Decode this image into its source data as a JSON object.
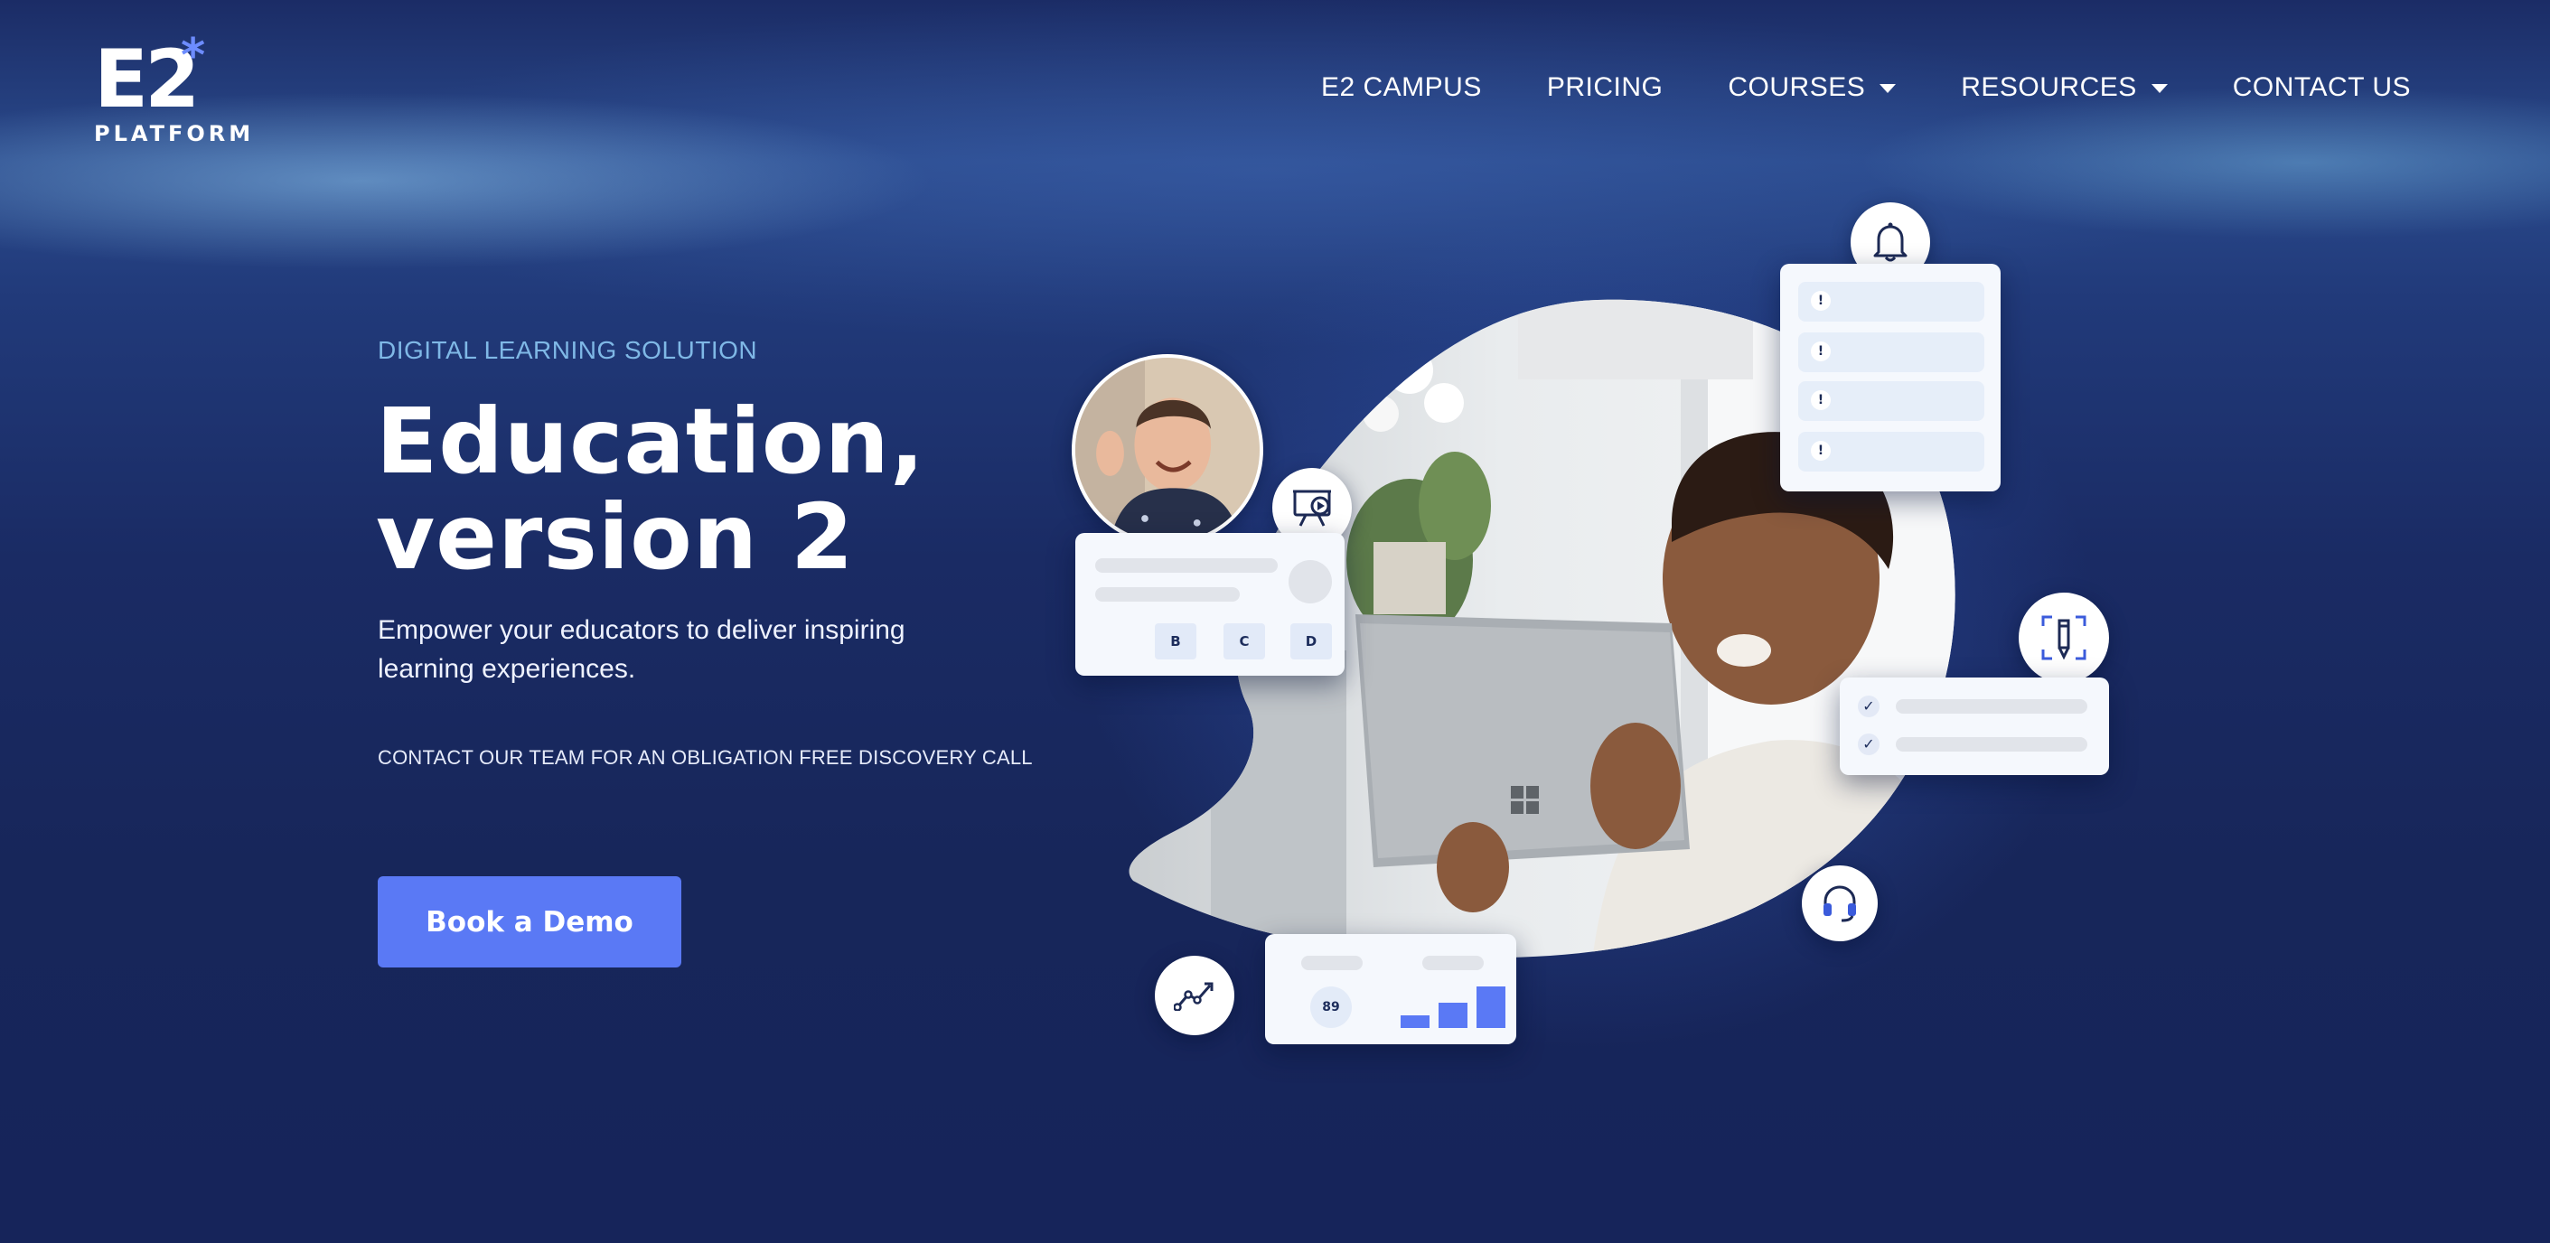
{
  "logo": {
    "mark": "E2",
    "star": "*",
    "sub": "PLATFORM"
  },
  "nav": {
    "campus": "E2 CAMPUS",
    "pricing": "PRICING",
    "courses": "COURSES",
    "resources": "RESOURCES",
    "contact": "CONTACT US"
  },
  "hero": {
    "eyebrow": "DIGITAL LEARNING SOLUTION",
    "headline_line1": "Education,",
    "headline_line2": "version 2",
    "subtitle": "Empower your educators to deliver inspiring learning experiences.",
    "cta_note": "CONTACT OUR TEAM FOR AN OBLIGATION FREE DISCOVERY CALL",
    "button_label": "Book a Demo"
  },
  "illustration": {
    "quiz_options": [
      "B",
      "C",
      "D"
    ],
    "notification_marks": [
      "!",
      "!",
      "!",
      "!"
    ],
    "score": "89",
    "progress_bars": [
      0.3,
      0.6,
      1.0
    ],
    "accent_color": "#5a79f5",
    "icons": [
      "bell-icon",
      "presentation-icon",
      "design-tools-icon",
      "headset-icon",
      "trend-chart-icon"
    ]
  },
  "colors": {
    "background": "#18285e",
    "accent": "#5a79f5",
    "eyebrow": "#7fb8e6"
  }
}
